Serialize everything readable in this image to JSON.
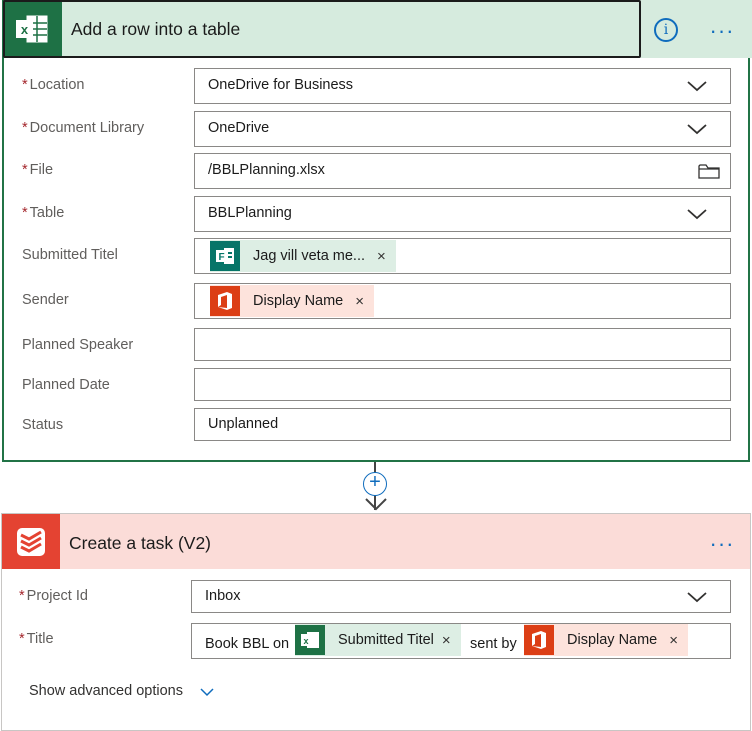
{
  "colors": {
    "excel_green": "#1e7145",
    "office_red": "#dc3e15",
    "todoist_red": "#e44332",
    "link_blue": "#0f6cbd",
    "required_red": "#a4262c"
  },
  "action1": {
    "title": "Add a row into a table",
    "app_icon": "excel-icon",
    "fields": {
      "location": {
        "label": "Location",
        "required": "*",
        "value": "OneDrive for Business"
      },
      "library": {
        "label": "Document Library",
        "required": "*",
        "value": "OneDrive"
      },
      "file": {
        "label": "File",
        "required": "*",
        "value": "/BBLPlanning.xlsx"
      },
      "table": {
        "label": "Table",
        "required": "*",
        "value": "BBLPlanning"
      },
      "submitted": {
        "label": "Submitted Titel",
        "token": "Jag vill veta me..."
      },
      "sender": {
        "label": "Sender",
        "token": "Display Name"
      },
      "speaker": {
        "label": "Planned Speaker",
        "value": ""
      },
      "date": {
        "label": "Planned Date",
        "value": ""
      },
      "status": {
        "label": "Status",
        "value": "Unplanned"
      }
    }
  },
  "connector": {
    "plus": "+"
  },
  "action2": {
    "title": "Create a task (V2)",
    "app_icon": "todoist-icon",
    "fields": {
      "project": {
        "label": "Project Id",
        "required": "*",
        "value": "Inbox"
      },
      "title": {
        "label": "Title",
        "required": "*",
        "text1": "Book BBL on",
        "token1": "Submitted Titel",
        "text2": "sent by",
        "token2": "Display Name"
      }
    },
    "advanced": "Show advanced options"
  },
  "token_remove": "×"
}
